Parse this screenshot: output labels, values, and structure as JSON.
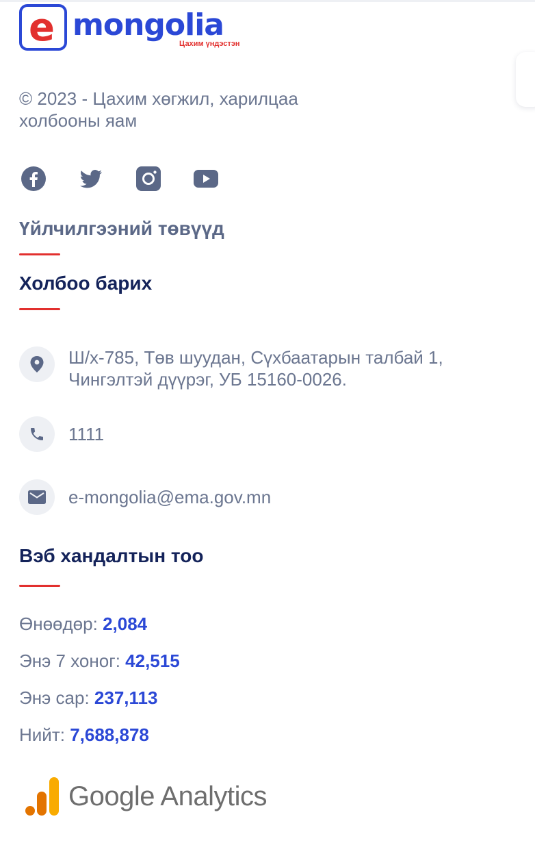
{
  "logo": {
    "letter": "e",
    "word": "mongolia",
    "tagline": "Цахим үндэстэн"
  },
  "footer": {
    "copyright": "© 2023 - Цахим хөгжил, харилцаа холбооны яам",
    "social": [
      "facebook-icon",
      "twitter-icon",
      "instagram-icon",
      "youtube-icon"
    ]
  },
  "sections": {
    "service_centers": "Үйлчилгээний төвүүд",
    "contact": "Холбоо барих",
    "visits": "Вэб хандалтын тоо"
  },
  "contact": {
    "address": "Ш/х-785, Төв шуудан, Сүхбаатарын талбай 1, Чингэлтэй дүүрэг, УБ 15160-0026.",
    "phone": "1111",
    "email": "e-mongolia@ema.gov.mn"
  },
  "stats": [
    {
      "label": "Өнөөдөр:",
      "value": "2,084"
    },
    {
      "label": "Энэ 7 хоног:",
      "value": "42,515"
    },
    {
      "label": "Энэ сар:",
      "value": "237,113"
    },
    {
      "label": "Нийт:",
      "value": "7,688,878"
    }
  ],
  "analytics": {
    "label": "Google Analytics"
  },
  "colors": {
    "accent": "#2b48d6",
    "red": "#e2302e",
    "title_dark": "#14235a",
    "title_muted": "#5b6887"
  }
}
